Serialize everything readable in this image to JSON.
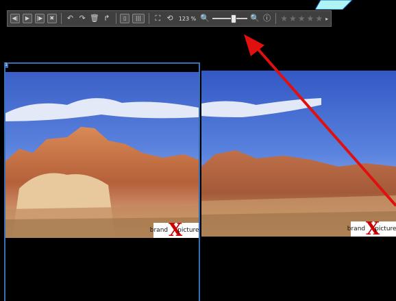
{
  "toolbar": {
    "zoom_level": "123 %",
    "zoom_slider_fraction": 0.5,
    "rating": 0,
    "rating_max": 5,
    "icons": [
      "prev-frame-icon",
      "play-icon",
      "next-frame-icon",
      "close-icon",
      "undo-icon",
      "redo-icon",
      "delete-icon",
      "share-icon",
      "single-view-icon",
      "grid-view-icon",
      "fit-icon",
      "rotate-icon",
      "zoom-out-icon",
      "zoom-in-icon",
      "info-icon"
    ]
  },
  "panes": {
    "left_badge": "1",
    "watermark_left": {
      "prefix": "brand",
      "letter": "X",
      "suffix": "pictures"
    },
    "watermark_right": {
      "prefix": "brand",
      "letter": "X",
      "suffix": "pictures"
    }
  },
  "colors": {
    "accent": "#3b6fb5",
    "annotation": "#e01010",
    "callout": "#33e6e6"
  }
}
